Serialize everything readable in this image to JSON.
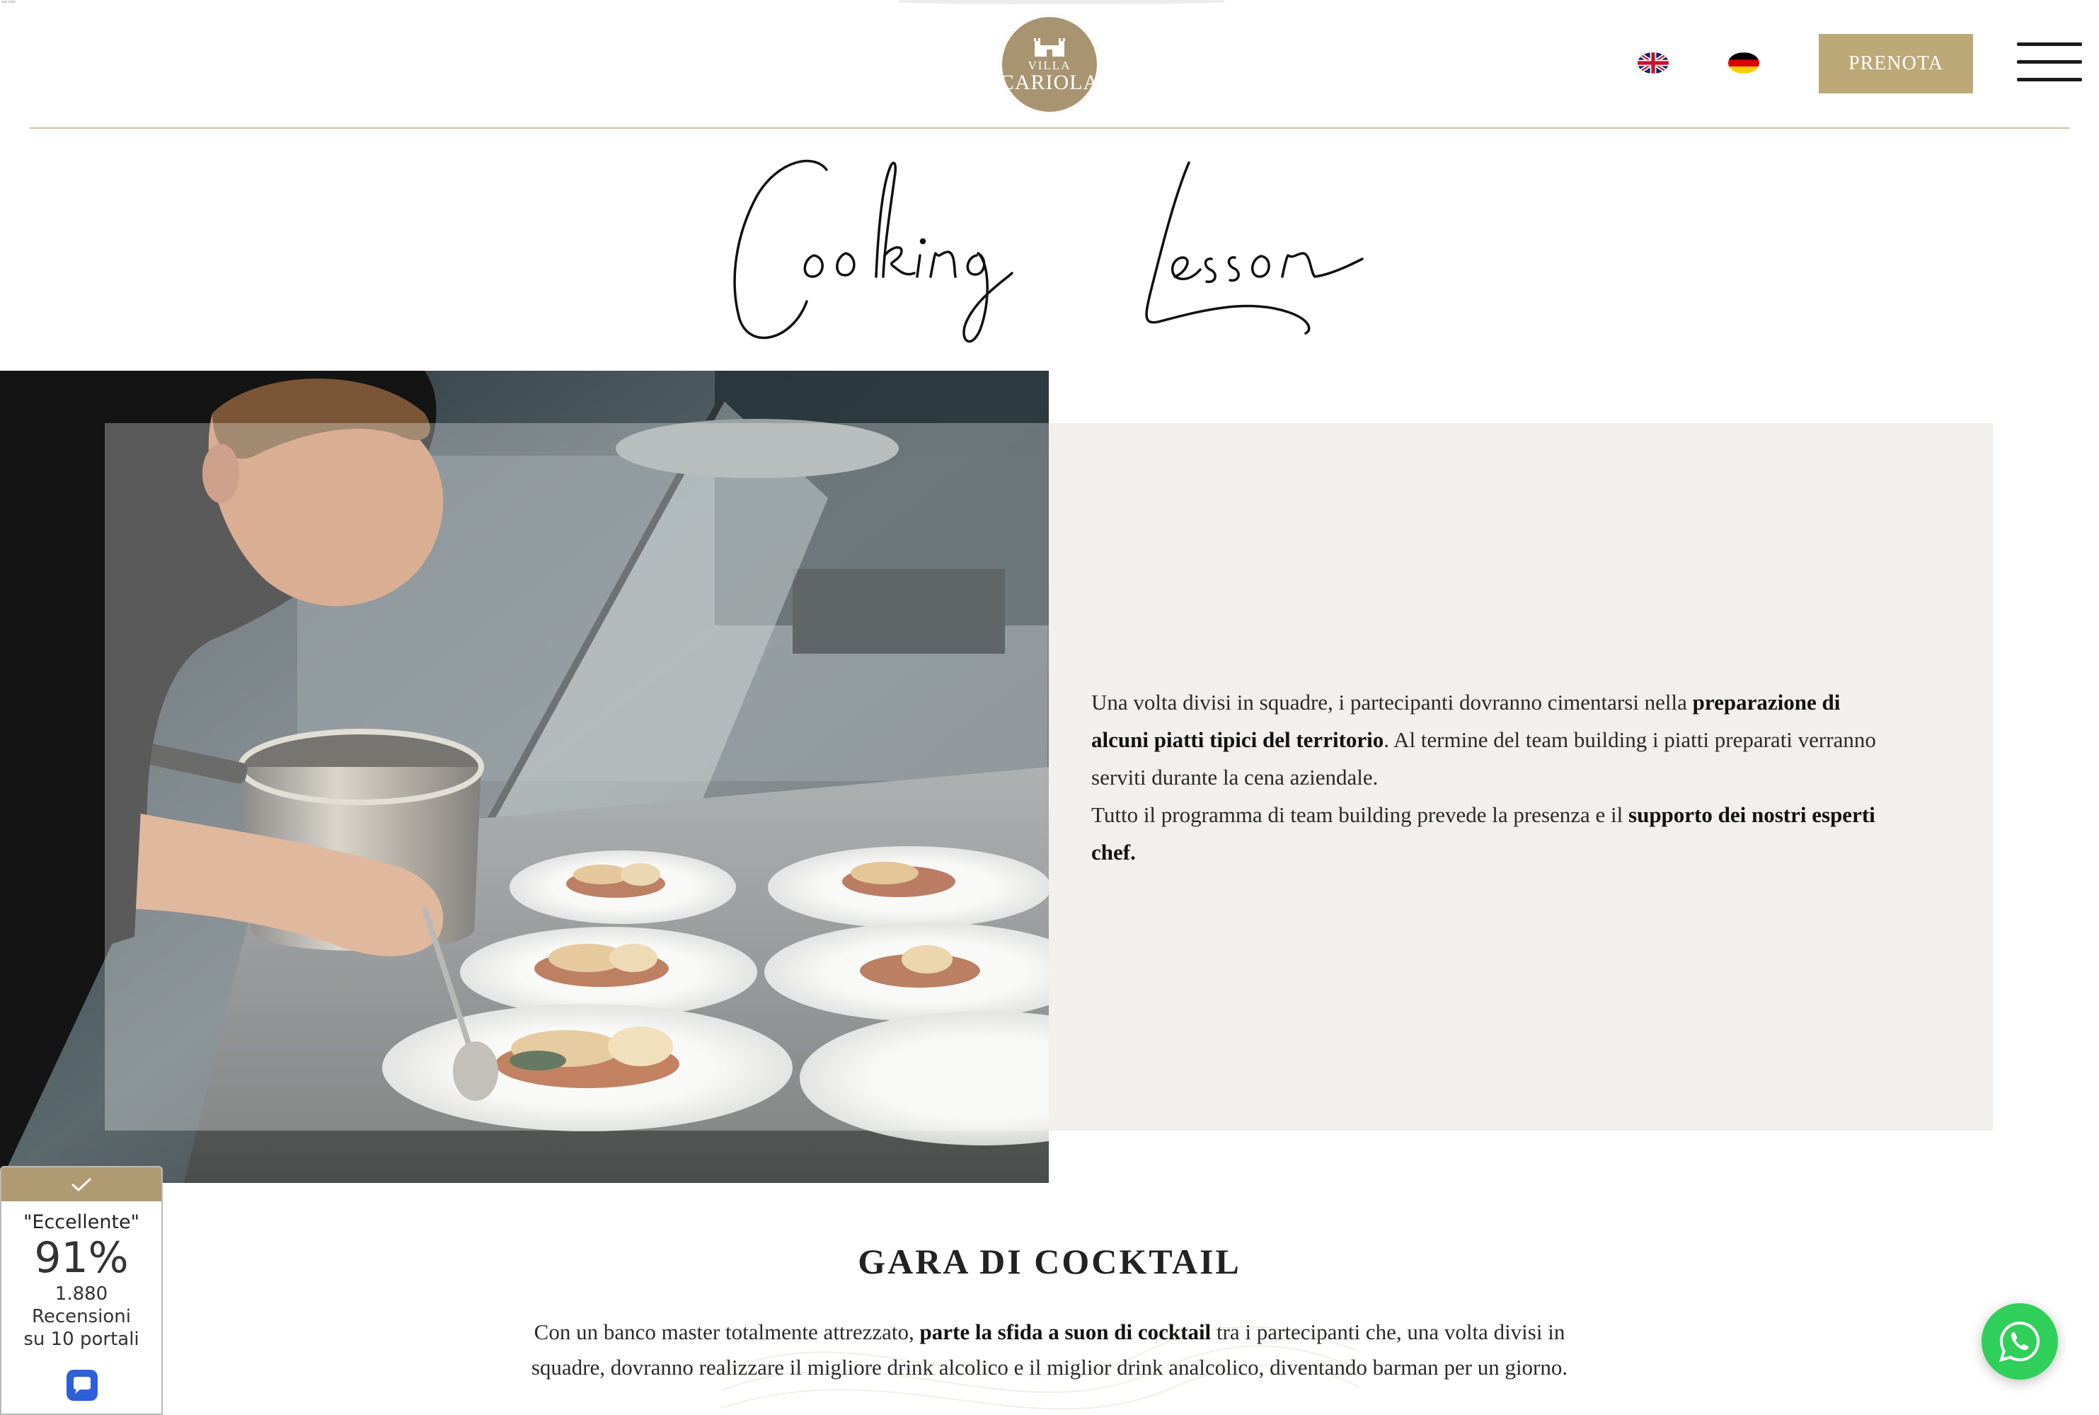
{
  "header": {
    "corner_mark": "var.com",
    "logo": {
      "line1": "VILLA",
      "line2": "CARIOLA"
    },
    "languages": [
      {
        "code": "en",
        "icon": "uk-flag-icon"
      },
      {
        "code": "de",
        "icon": "germany-flag-icon"
      }
    ],
    "book_label": "PRENOTA",
    "menu_icon": "hamburger-menu-icon",
    "accent_color": "#bda977"
  },
  "title": "Cooking Lesson",
  "info": {
    "p1_a": "Una volta divisi in squadre, i partecipanti dovranno cimentarsi nella ",
    "p1_b": "preparazione di alcuni piatti tipici del territorio",
    "p1_c": ". Al termine del team building i piatti preparati verranno serviti durante la cena aziendale.",
    "p2_a": "Tutto il programma di team building prevede la presenza e il ",
    "p2_b": "supporto dei nostri esperti chef."
  },
  "cocktail": {
    "title": "GARA DI COCKTAIL",
    "text_a": "Con un banco master totalmente attrezzato, ",
    "text_b": "parte la sfida a suon di cocktail",
    "text_c": " tra i partecipanti che, una volta divisi in squadre, dovranno realizzare il migliore drink alcolico e il miglior drink analcolico, diventando barman per un giorno."
  },
  "review": {
    "rating_label": "\"Eccellente\"",
    "score": "91%",
    "count": "1.880",
    "count_label": "Recensioni",
    "portals": "su 10 portali",
    "check_icon": "check-icon",
    "logo_icon": "review-chat-icon"
  },
  "whatsapp_icon": "whatsapp-icon"
}
